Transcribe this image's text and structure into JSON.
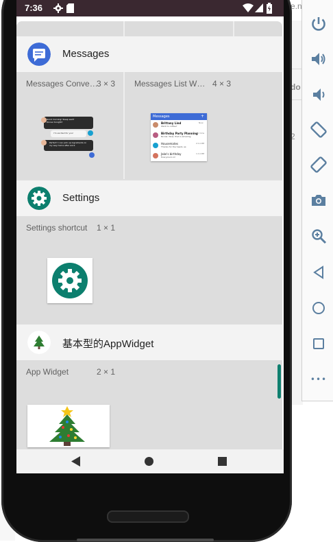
{
  "background_window": {
    "right_fragment_chars": [
      "e.n",
      "do",
      "2"
    ]
  },
  "status_bar": {
    "time": "7:36"
  },
  "widget_picker": {
    "groups": [
      {
        "app_name": "Messages",
        "widgets": [
          {
            "label": "Messages Conve…",
            "size": "3 × 3"
          },
          {
            "label": "Messages List W…",
            "size": "4 × 3"
          }
        ],
        "preview_conversation": {
          "bubbles": [
            "Good morning! Sleep well? Dinner tonight?",
            "I'm excited for you!",
            "Perfect! I can pick up ingredients on my way home after work"
          ],
          "times": [
            "Nov 12, 8:17 PM",
            "Nov 12, 8:31 PM"
          ]
        },
        "preview_list": {
          "title": "Messages",
          "items": [
            {
              "name": "Brittany Lind",
              "snippet": "Want to coffee?",
              "time": "Now"
            },
            {
              "name": "Birthday Party Planning",
              "snippet": "Nicole: Wow, that is amazing.",
              "time": "5 mins"
            },
            {
              "name": "Housemates",
              "snippet": "Thanks for the heads up",
              "time": "2:14 PM"
            },
            {
              "name": "Jake's birthday",
              "snippet": "Everyone's in!",
              "time": "1:14 PM"
            }
          ]
        }
      },
      {
        "app_name": "Settings",
        "widgets": [
          {
            "label": "Settings shortcut",
            "size": "1 × 1"
          }
        ]
      },
      {
        "app_name": "基本型的AppWidget",
        "widgets": [
          {
            "label": "App Widget",
            "size": "2 × 1"
          }
        ]
      }
    ]
  },
  "colors": {
    "messages_blue": "#3d6bd6",
    "settings_teal": "#0c7f6e",
    "scroll_thumb": "#0f7f6f",
    "toolbar_icon": "#5b7fa0"
  },
  "toolbar": {
    "buttons": [
      {
        "name": "power-icon"
      },
      {
        "name": "volume-up-icon"
      },
      {
        "name": "volume-down-icon"
      },
      {
        "name": "rotate-left-icon"
      },
      {
        "name": "rotate-right-icon"
      },
      {
        "name": "camera-icon"
      },
      {
        "name": "zoom-icon"
      },
      {
        "name": "back-icon"
      },
      {
        "name": "home-icon"
      },
      {
        "name": "overview-icon"
      },
      {
        "name": "more-icon"
      }
    ],
    "more_label": "•••"
  }
}
